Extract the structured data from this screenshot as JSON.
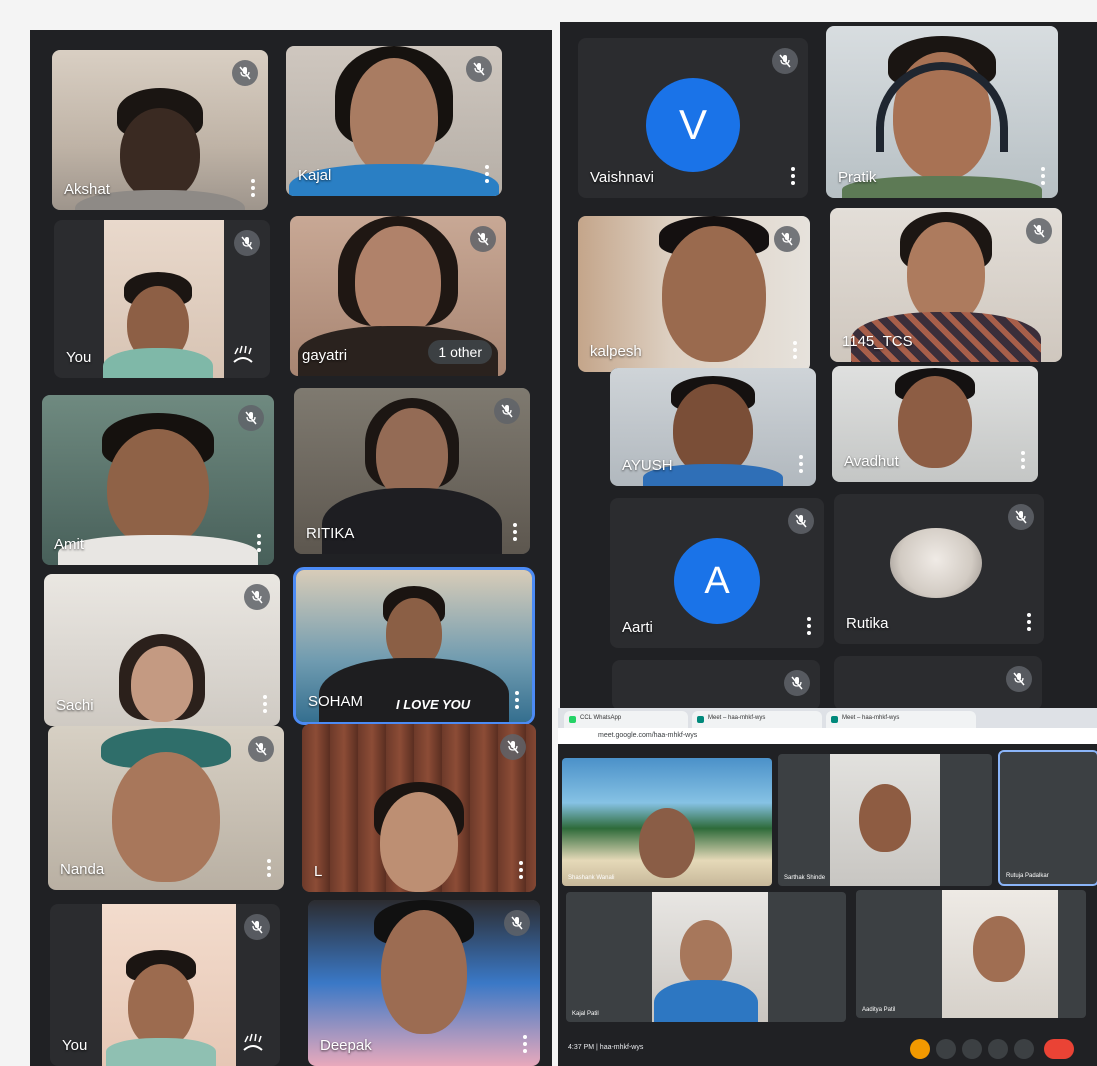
{
  "participants_left": [
    {
      "name": "Akshat",
      "tile": "akshat"
    },
    {
      "name": "Kajal",
      "tile": "kajal"
    },
    {
      "name": "You",
      "tile": "you1"
    },
    {
      "name": "gayatri",
      "tile": "gayatri",
      "pill": "1 other"
    },
    {
      "name": "Amit",
      "tile": "amit"
    },
    {
      "name": "RITIKA",
      "tile": "ritika"
    },
    {
      "name": "Sachi",
      "tile": "sachi"
    },
    {
      "name": "SOHAM",
      "tile": "soham",
      "shirt_text": "I LOVE YOU"
    },
    {
      "name": "Nanda",
      "tile": "nanda"
    },
    {
      "name": "L",
      "tile": "l"
    },
    {
      "name": "You",
      "tile": "you2"
    },
    {
      "name": "Deepak",
      "tile": "deepak"
    }
  ],
  "participants_right": [
    {
      "name": "Vaishnavi",
      "avatar_letter": "V"
    },
    {
      "name": "Pratik"
    },
    {
      "name": "kalpesh"
    },
    {
      "name": "1145_TCS"
    },
    {
      "name": "AYUSH"
    },
    {
      "name": "Avadhut"
    },
    {
      "name": "Aarti",
      "avatar_letter": "A"
    },
    {
      "name": "Rutika"
    }
  ],
  "screen_share": {
    "tabs": [
      "CCL WhatsApp",
      "Meet – haa-mhkf-wys",
      "Meet – haa-mhkf-wys"
    ],
    "url": "meet.google.com/haa-mhkf-wys",
    "participants": [
      "Shashank Wanali",
      "Sarthak Shinde",
      "Rutuja Padalkar",
      "Kajal Patil",
      "Aaditya Patil"
    ],
    "clock": "4:37 PM",
    "meeting_code": "haa-mhkf-wys"
  },
  "icons": [
    "mic-off-icon",
    "more-options-icon",
    "hand-raise-icon",
    "end-call-icon",
    "camera-icon",
    "captions-icon",
    "present-icon"
  ],
  "colors": {
    "background": "#202124",
    "tile": "#3c4043",
    "avatar_blue": "#1a73e8",
    "active_border": "#4c8bf5",
    "end_call": "#ea4335"
  }
}
